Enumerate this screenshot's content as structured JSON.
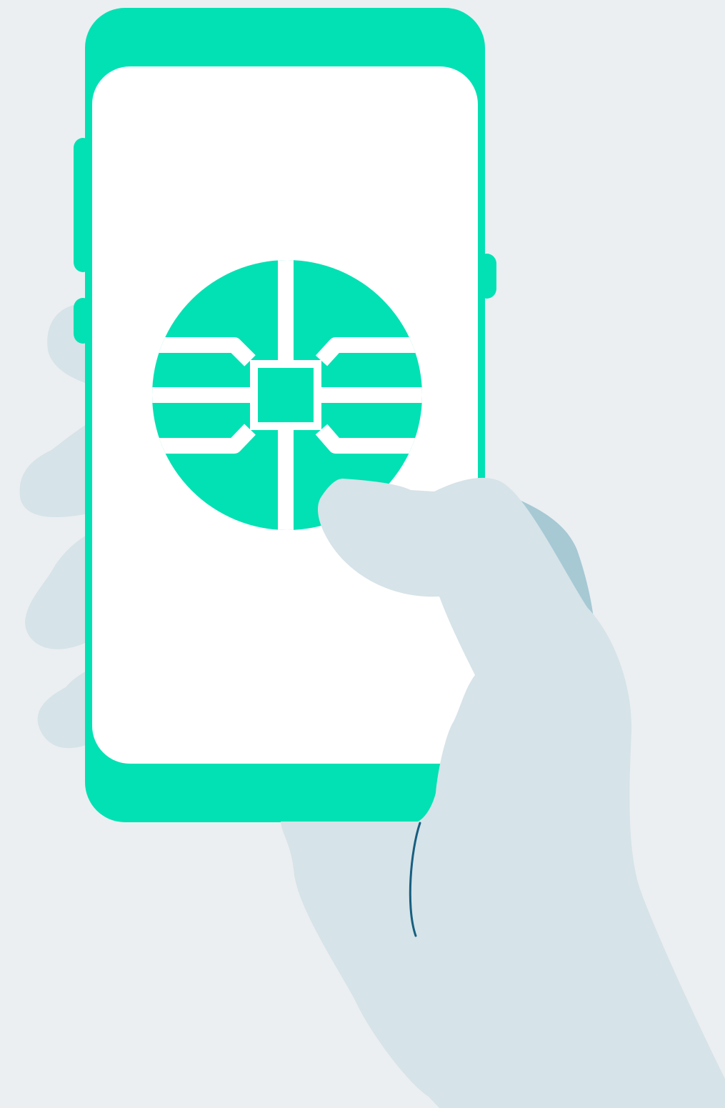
{
  "colors": {
    "background": "#ebeff2",
    "phone_body": "#02e1b4",
    "screen": "#ffffff",
    "hand": "#d6e3e8",
    "hand_shadow": "#a6c9d4",
    "line": "#175f80"
  },
  "icons": {
    "screen_icon": "chip-icon"
  }
}
